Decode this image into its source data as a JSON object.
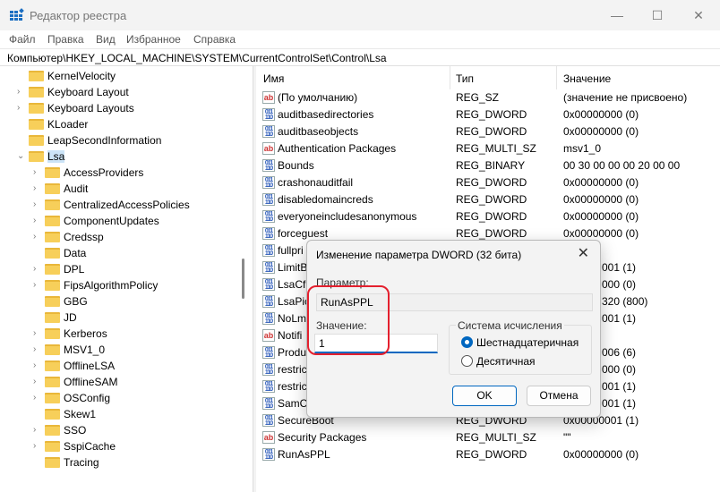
{
  "window": {
    "title": "Редактор реестра",
    "minimize": "—",
    "maximize": "☐",
    "close": "✕"
  },
  "menu": [
    "Файл",
    "Правка",
    "Вид",
    "Избранное",
    "Справка"
  ],
  "address": "Компьютер\\HKEY_LOCAL_MACHINE\\SYSTEM\\CurrentControlSet\\Control\\Lsa",
  "tree": [
    {
      "label": "KernelVelocity",
      "level": 0,
      "exp": ""
    },
    {
      "label": "Keyboard Layout",
      "level": 0,
      "exp": "›"
    },
    {
      "label": "Keyboard Layouts",
      "level": 0,
      "exp": "›"
    },
    {
      "label": "KLoader",
      "level": 0,
      "exp": ""
    },
    {
      "label": "LeapSecondInformation",
      "level": 0,
      "exp": ""
    },
    {
      "label": "Lsa",
      "level": 0,
      "exp": "⌄",
      "selected": true
    },
    {
      "label": "AccessProviders",
      "level": 1,
      "exp": "›"
    },
    {
      "label": "Audit",
      "level": 1,
      "exp": "›"
    },
    {
      "label": "CentralizedAccessPolicies",
      "level": 1,
      "exp": "›"
    },
    {
      "label": "ComponentUpdates",
      "level": 1,
      "exp": "›"
    },
    {
      "label": "Credssp",
      "level": 1,
      "exp": "›"
    },
    {
      "label": "Data",
      "level": 1,
      "exp": ""
    },
    {
      "label": "DPL",
      "level": 1,
      "exp": "›"
    },
    {
      "label": "FipsAlgorithmPolicy",
      "level": 1,
      "exp": "›"
    },
    {
      "label": "GBG",
      "level": 1,
      "exp": ""
    },
    {
      "label": "JD",
      "level": 1,
      "exp": ""
    },
    {
      "label": "Kerberos",
      "level": 1,
      "exp": "›"
    },
    {
      "label": "MSV1_0",
      "level": 1,
      "exp": "›"
    },
    {
      "label": "OfflineLSA",
      "level": 1,
      "exp": "›"
    },
    {
      "label": "OfflineSAM",
      "level": 1,
      "exp": "›"
    },
    {
      "label": "OSConfig",
      "level": 1,
      "exp": "›"
    },
    {
      "label": "Skew1",
      "level": 1,
      "exp": ""
    },
    {
      "label": "SSO",
      "level": 1,
      "exp": "›"
    },
    {
      "label": "SspiCache",
      "level": 1,
      "exp": "›"
    },
    {
      "label": "Tracing",
      "level": 1,
      "exp": ""
    }
  ],
  "columns": {
    "name": "Имя",
    "type": "Тип",
    "value": "Значение"
  },
  "rows": [
    {
      "icon": "sz",
      "name": "(По умолчанию)",
      "type": "REG_SZ",
      "value": "(значение не присвоено)"
    },
    {
      "icon": "bin",
      "name": "auditbasedirectories",
      "type": "REG_DWORD",
      "value": "0x00000000 (0)"
    },
    {
      "icon": "bin",
      "name": "auditbaseobjects",
      "type": "REG_DWORD",
      "value": "0x00000000 (0)"
    },
    {
      "icon": "sz",
      "name": "Authentication Packages",
      "type": "REG_MULTI_SZ",
      "value": "msv1_0"
    },
    {
      "icon": "bin",
      "name": "Bounds",
      "type": "REG_BINARY",
      "value": "00 30 00 00 00 20 00 00"
    },
    {
      "icon": "bin",
      "name": "crashonauditfail",
      "type": "REG_DWORD",
      "value": "0x00000000 (0)"
    },
    {
      "icon": "bin",
      "name": "disabledomaincreds",
      "type": "REG_DWORD",
      "value": "0x00000000 (0)"
    },
    {
      "icon": "bin",
      "name": "everyoneincludesanonymous",
      "type": "REG_DWORD",
      "value": "0x00000000 (0)"
    },
    {
      "icon": "bin",
      "name": "forceguest",
      "type": "REG_DWORD",
      "value": "0x00000000 (0)"
    },
    {
      "icon": "bin",
      "name": "fullpri",
      "type": "",
      "value": "",
      "partial": true
    },
    {
      "icon": "bin",
      "name": "LimitB",
      "type": "",
      "value": "001 (1)",
      "partial": true
    },
    {
      "icon": "bin",
      "name": "LsaCf",
      "type": "",
      "value": "000 (0)",
      "partial": true
    },
    {
      "icon": "bin",
      "name": "LsaPic",
      "type": "",
      "value": "320 (800)",
      "partial": true
    },
    {
      "icon": "bin",
      "name": "NoLm",
      "type": "",
      "value": "001 (1)",
      "partial": true
    },
    {
      "icon": "sz",
      "name": "Notifi",
      "type": "",
      "value": "",
      "partial": true
    },
    {
      "icon": "bin",
      "name": "Produ",
      "type": "",
      "value": "006 (6)",
      "partial": true
    },
    {
      "icon": "bin",
      "name": "restric",
      "type": "",
      "value": "000 (0)",
      "partial": true
    },
    {
      "icon": "bin",
      "name": "restric",
      "type": "",
      "value": "001 (1)",
      "partial": true
    },
    {
      "icon": "bin",
      "name": "SamC",
      "type": "",
      "value": "001 (1)",
      "partial": true
    },
    {
      "icon": "bin",
      "name": "SecureBoot",
      "type": "REG_DWORD",
      "value": "0x00000001 (1)"
    },
    {
      "icon": "sz",
      "name": "Security Packages",
      "type": "REG_MULTI_SZ",
      "value": "\"\""
    },
    {
      "icon": "bin",
      "name": "RunAsPPL",
      "type": "REG_DWORD",
      "value": "0x00000000 (0)"
    }
  ],
  "dialog": {
    "title": "Изменение параметра DWORD (32 бита)",
    "param_label": "Параметр:",
    "param_value": "RunAsPPL",
    "value_label": "Значение:",
    "value": "1",
    "base_title": "Система исчисления",
    "hex": "Шестнадцатеричная",
    "dec": "Десятичная",
    "ok": "OK",
    "cancel": "Отмена",
    "close": "✕",
    "selected_base": "hex"
  },
  "colors": {
    "accent": "#0067c0",
    "highlight": "#e4202e",
    "selection": "#cce4f7"
  }
}
